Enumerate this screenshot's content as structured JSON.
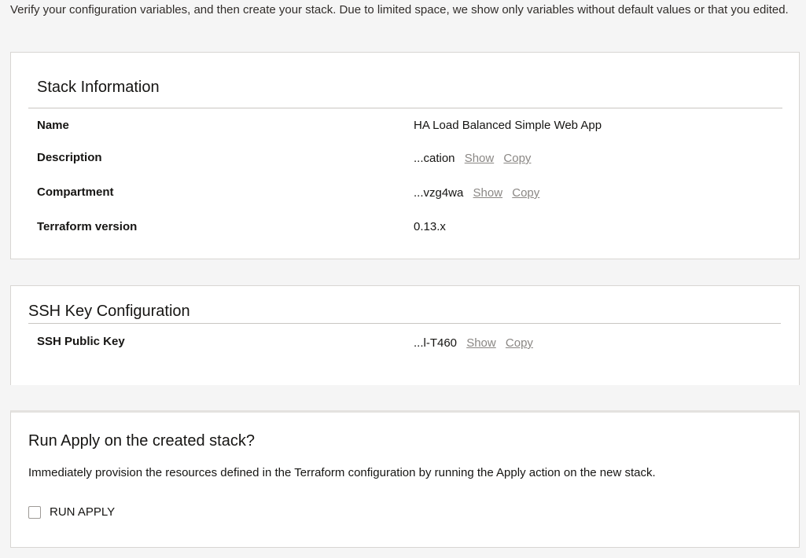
{
  "intro_text": "Verify your configuration variables, and then create your stack. Due to limited space, we show only variables without default values or that you edited.",
  "stack_info": {
    "title": "Stack Information",
    "rows": [
      {
        "label": "Name",
        "value": "HA Load Balanced Simple Web App"
      },
      {
        "label": "Description",
        "value": "...cation",
        "show": "Show",
        "copy": "Copy"
      },
      {
        "label": "Compartment",
        "value": "...vzg4wa",
        "show": "Show",
        "copy": "Copy"
      },
      {
        "label": "Terraform version",
        "value": "0.13.x"
      }
    ]
  },
  "ssh_config": {
    "title": "SSH Key Configuration",
    "rows": [
      {
        "label": "SSH Public Key",
        "value": "...l-T460",
        "show": "Show",
        "copy": "Copy"
      }
    ]
  },
  "run_apply": {
    "title": "Run Apply on the created stack?",
    "description": "Immediately provision the resources defined in the Terraform configuration by running the Apply action on the new stack.",
    "checkbox_label": "RUN APPLY",
    "checked": false
  }
}
